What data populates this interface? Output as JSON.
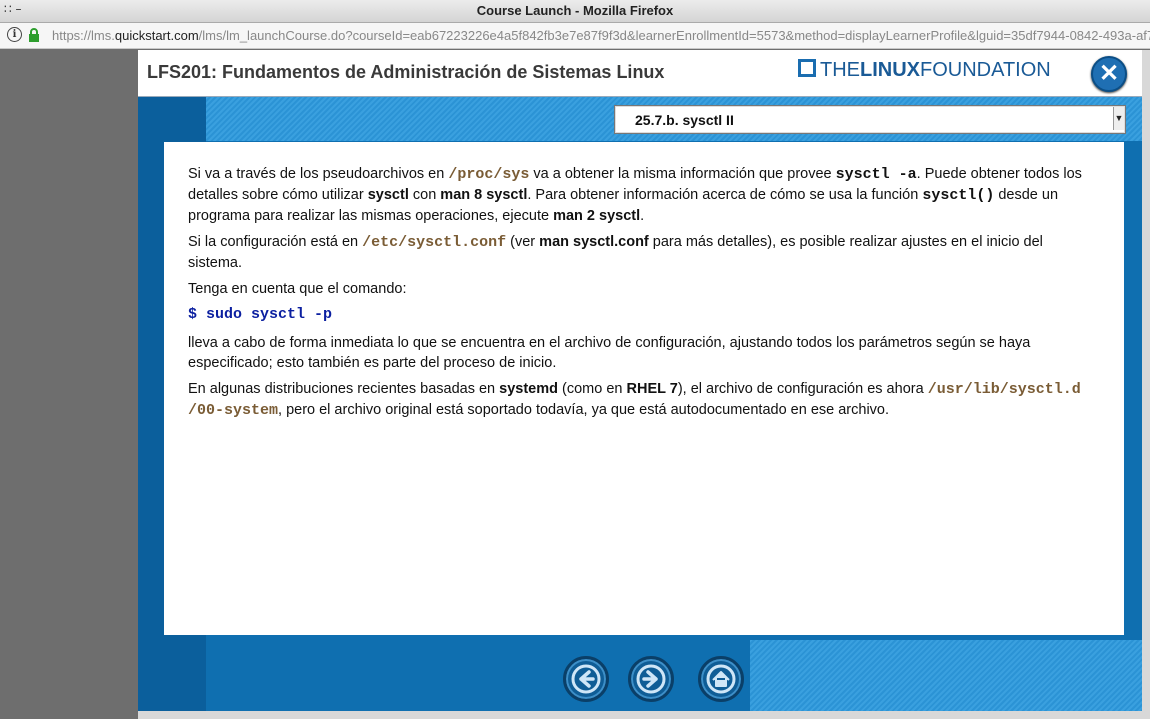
{
  "window": {
    "title": "Course Launch - Mozilla Firefox",
    "controls": "∷ –"
  },
  "urlbar": {
    "prefix": "https://lms.",
    "domain": "quickstart.com",
    "rest": "/lms/lm_launchCourse.do?courseId=eab67223226e4a5f842fb3e7e87f9f3d&learnerEnrollmentId=5573&method=displayLearnerProfile&lguid=35df7944-0842-493a-af7"
  },
  "header": {
    "course_title": "LFS201: Fundamentos de Administración de Sistemas Linux",
    "logo_the": "THE",
    "logo_linux": "LINUX",
    "logo_foundation": "FOUNDATION",
    "close_glyph": "✕"
  },
  "section_select": {
    "selected": "25.7.b. sysctl II"
  },
  "content": {
    "p1": {
      "a": "Si va a través de los pseudoarchivos en ",
      "path1": "/proc/sys",
      "b": " va a obtener la misma información que provee ",
      "cmd1": "sysctl -a",
      "c": ". Puede obtener todos los detalles sobre cómo utilizar ",
      "bold1": "sysctl",
      "d": " con ",
      "bold2": "man 8 sysctl",
      "e": ". Para obtener información acerca de cómo se usa la función ",
      "cmd2": "sysctl()",
      "f": " desde un programa para realizar las mismas operaciones, ejecute ",
      "bold3": "man 2 sysctl",
      "g": "."
    },
    "p2": {
      "a": "Si la configuración está en ",
      "path": "/etc/sysctl.conf",
      "b": " (ver ",
      "bold": "man sysctl.conf",
      "c": " para más detalles), es posible realizar ajustes en el inicio del sistema."
    },
    "p3": "Tenga en cuenta que el comando:",
    "code": "$ sudo sysctl -p",
    "p4": "lleva a cabo de forma inmediata lo que se encuentra en el archivo de configuración, ajustando todos los parámetros según se haya especificado; esto también es parte del proceso de inicio.",
    "p5": {
      "a": "En algunas distribuciones recientes basadas en ",
      "bold1": "systemd",
      "b": " (como en ",
      "bold2": "RHEL 7",
      "c": "), el archivo de configuración es ahora ",
      "path1": "/usr/lib/sysctl.d",
      "path2": "/00-system",
      "d": ", pero el archivo original está soportado todavía, ya que está autodocumentado en ese archivo."
    }
  },
  "navigation": {
    "prev_icon": "arrow-left-icon",
    "next_icon": "arrow-right-icon",
    "home_icon": "home-icon"
  },
  "colors": {
    "frame_blue": "#0f6fb0",
    "stripe_blue": "#3aa0df",
    "path_brown": "#7a5c35",
    "code_blue": "#0b1fa0"
  }
}
